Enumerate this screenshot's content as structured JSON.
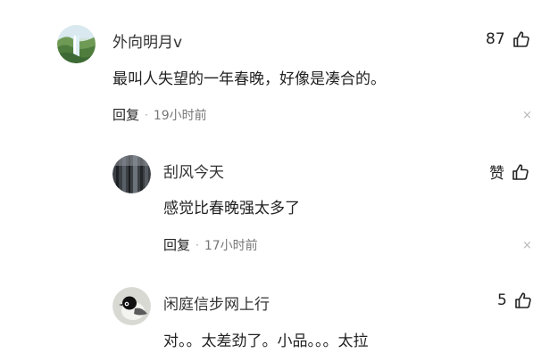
{
  "comments": [
    {
      "username": "外向明月v",
      "text": "最叫人失望的一年春晚，好像是凑合的。",
      "likes": "87",
      "reply_label": "回复",
      "time": "19小时前",
      "close_glyph": "×",
      "avatar_icon": "avatar-landscape-waterfall-icon"
    },
    {
      "username": "刮风今天",
      "text": "感觉比春晚强太多了",
      "likes": "赞",
      "reply_label": "回复",
      "time": "17小时前",
      "close_glyph": "×",
      "avatar_icon": "avatar-forest-icon"
    },
    {
      "username": "闲庭信步网上行",
      "text": "对。。太差劲了。小品。。。太拉",
      "likes": "5",
      "avatar_icon": "avatar-bird-icon"
    }
  ],
  "separator_dot": "·",
  "colors": {
    "text": "#222222",
    "muted": "#777777",
    "close": "#b6b6b6"
  }
}
